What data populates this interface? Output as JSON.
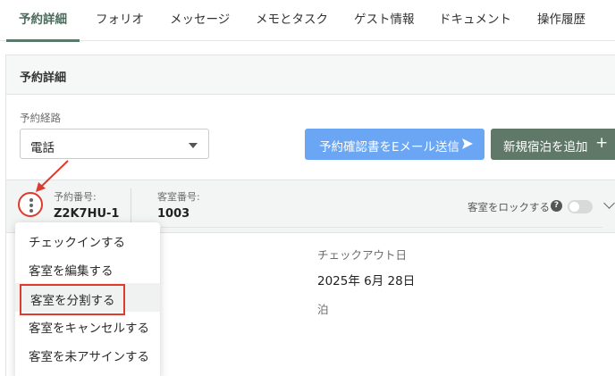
{
  "tabs": [
    "予約詳細",
    "フォリオ",
    "メッセージ",
    "メモとタスク",
    "ゲスト情報",
    "ドキュメント",
    "操作履歴"
  ],
  "panel": {
    "title": "予約詳細"
  },
  "booking_source": {
    "label": "予約経路",
    "value": "電話"
  },
  "buttons": {
    "email_confirmation": "予約確認書をEメール送信",
    "add_stay": "新規宿泊を追加",
    "add_stay_icon": "+"
  },
  "reservation": {
    "number_label": "予約番号:",
    "number_value": "Z2K7HU-1",
    "room_label": "客室番号:",
    "room_value": "1003",
    "lock_label": "客室をロックする",
    "help_icon": "?"
  },
  "details": {
    "checkout_label": "チェックアウト日",
    "checkout_value": "2025年 6月 28日",
    "nights_label": "泊"
  },
  "menu": {
    "items": [
      "チェックインする",
      "客室を編集する",
      "客室を分割する",
      "客室をキャンセルする",
      "客室を未アサインする"
    ],
    "highlighted": "客室を分割する"
  },
  "colors": {
    "accent_green": "#5f7868",
    "email_blue": "#6aa6f3",
    "annotation_red": "#e03a2e"
  },
  "icons": [
    "kebab-menu-icon",
    "send-icon",
    "plus-icon",
    "help-icon",
    "chevron-down-icon",
    "caret-down-icon"
  ]
}
